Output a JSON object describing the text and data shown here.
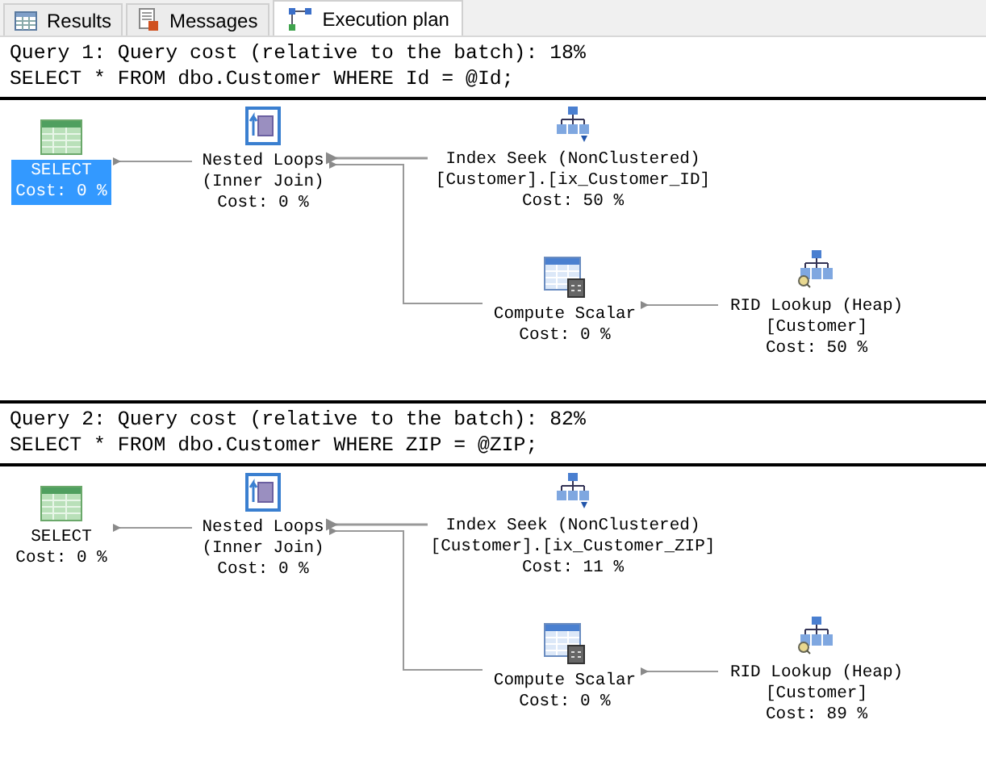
{
  "tabs": [
    {
      "label": "Results",
      "kind": "grid",
      "selected": false
    },
    {
      "label": "Messages",
      "kind": "doc",
      "selected": false
    },
    {
      "label": "Execution plan",
      "kind": "plan",
      "selected": true
    }
  ],
  "queries": [
    {
      "header": "Query 1: Query cost (relative to the batch): 18%",
      "sql": "SELECT * FROM dbo.Customer WHERE Id = @Id;",
      "nodes": [
        {
          "kind": "select",
          "lines": [
            "SELECT",
            "Cost: 0 %"
          ],
          "selected": true
        },
        {
          "kind": "loops",
          "lines": [
            "Nested Loops",
            "(Inner Join)",
            "Cost: 0 %"
          ],
          "selected": false
        },
        {
          "kind": "seek",
          "lines": [
            "Index Seek (NonClustered)",
            "[Customer].[ix_Customer_ID]",
            "Cost: 50 %"
          ],
          "selected": false
        },
        {
          "kind": "compute",
          "lines": [
            "Compute Scalar",
            "Cost: 0 %"
          ],
          "selected": false
        },
        {
          "kind": "lookup",
          "lines": [
            "RID Lookup (Heap)",
            "[Customer]",
            "Cost: 50 %"
          ],
          "selected": false
        }
      ]
    },
    {
      "header": "Query 2: Query cost (relative to the batch): 82%",
      "sql": "SELECT * FROM dbo.Customer WHERE ZIP = @ZIP;",
      "nodes": [
        {
          "kind": "select",
          "lines": [
            "SELECT",
            "Cost: 0 %"
          ],
          "selected": false
        },
        {
          "kind": "loops",
          "lines": [
            "Nested Loops",
            "(Inner Join)",
            "Cost: 0 %"
          ],
          "selected": false
        },
        {
          "kind": "seek",
          "lines": [
            "Index Seek (NonClustered)",
            "[Customer].[ix_Customer_ZIP]",
            "Cost: 11 %"
          ],
          "selected": false
        },
        {
          "kind": "compute",
          "lines": [
            "Compute Scalar",
            "Cost: 0 %"
          ],
          "selected": false
        },
        {
          "kind": "lookup",
          "lines": [
            "RID Lookup (Heap)",
            "[Customer]",
            "Cost: 89 %"
          ],
          "selected": false
        }
      ]
    }
  ]
}
